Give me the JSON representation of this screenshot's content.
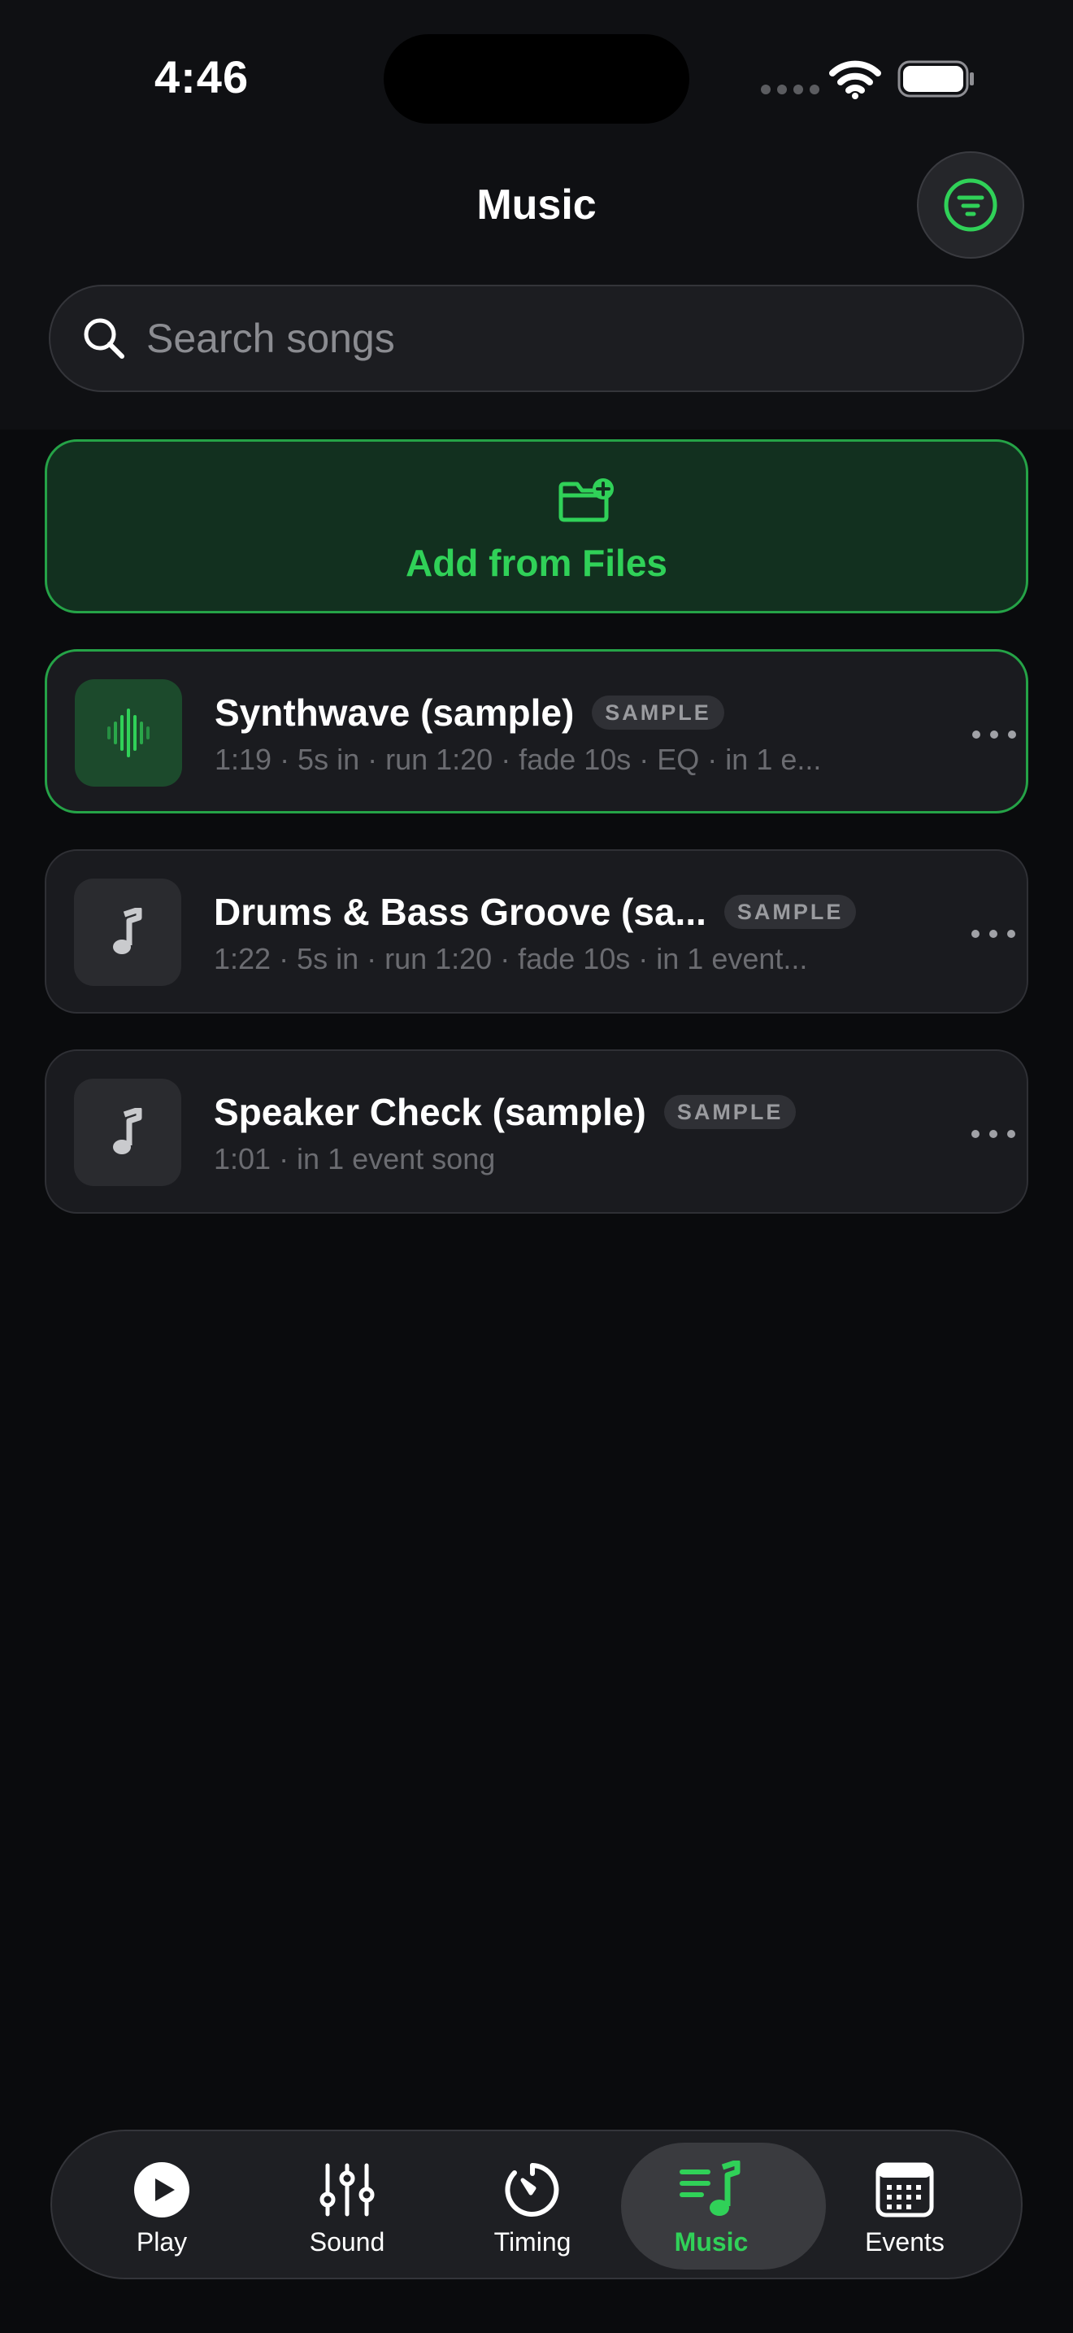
{
  "status_bar": {
    "time": "4:46"
  },
  "header": {
    "title": "Music"
  },
  "search": {
    "placeholder": "Search songs"
  },
  "add_files": {
    "label": "Add from Files"
  },
  "songs": [
    {
      "title": "Synthwave (sample)",
      "badge": "SAMPLE",
      "meta": "1:19 · 5s in · run 1:20 · fade 10s · EQ · in 1 e...",
      "thumb_icon": "waveform-icon",
      "active": true
    },
    {
      "title": "Drums & Bass Groove (sa...",
      "badge": "SAMPLE",
      "meta": "1:22 · 5s in · run 1:20 · fade 10s · in 1 event...",
      "thumb_icon": "music-note-icon",
      "active": false
    },
    {
      "title": "Speaker Check (sample)",
      "badge": "SAMPLE",
      "meta": "1:01 · in 1 event song",
      "thumb_icon": "music-note-icon",
      "active": false
    }
  ],
  "tabs": [
    {
      "label": "Play",
      "icon": "play-circle-icon"
    },
    {
      "label": "Sound",
      "icon": "sliders-icon"
    },
    {
      "label": "Timing",
      "icon": "timer-icon"
    },
    {
      "label": "Music",
      "icon": "music-list-icon",
      "selected": true
    },
    {
      "label": "Events",
      "icon": "calendar-icon"
    }
  ],
  "colors": {
    "accent": "#30d158",
    "background": "#0a0b0d",
    "card": "#1a1b1f"
  }
}
